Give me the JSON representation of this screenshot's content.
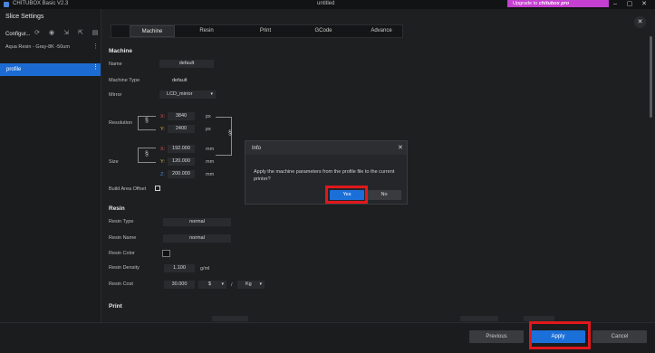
{
  "app": {
    "title": "CHITUBOX Basic V2.3",
    "document": "untitled",
    "upgrade_prefix": "Upgrade to",
    "upgrade_brand": "chitubox pro"
  },
  "window": {
    "minimize": "–",
    "maximize": "▢",
    "close": "✕"
  },
  "sidebar": {
    "title": "Slice Settings",
    "config_label": "Configur...",
    "resin_profile": "Aqua Resin - Gray-8K -50um",
    "selected_profile": "profile",
    "more": "⋮",
    "icons": [
      "refresh-icon",
      "view-icon",
      "import-icon",
      "export-icon",
      "document-icon"
    ]
  },
  "tabs": [
    {
      "label": "Machine",
      "active": true
    },
    {
      "label": "Resin",
      "active": false
    },
    {
      "label": "Print",
      "active": false
    },
    {
      "label": "GCode",
      "active": false
    },
    {
      "label": "Advance",
      "active": false
    }
  ],
  "machine": {
    "section": "Machine",
    "name_label": "Name",
    "name_value": "default",
    "type_label": "Machine Type",
    "type_value": "default",
    "mirror_label": "Mirror",
    "mirror_value": "LCD_mirror",
    "resolution_label": "Resolution",
    "res_x": "3840",
    "res_y": "2400",
    "res_unit": "px",
    "size_label": "Size",
    "size_x": "192.000",
    "size_y": "120.000",
    "size_z": "200.000",
    "size_unit": "mm",
    "build_offset_label": "Build Area Offset",
    "axis_x": "X:",
    "axis_y": "Y:",
    "axis_z": "Z:"
  },
  "resin": {
    "section": "Resin",
    "type_label": "Resin Type",
    "type_value": "normal",
    "name_label": "Resin Name",
    "name_value": "normal",
    "color_label": "Resin Color",
    "density_label": "Resin Density",
    "density_value": "1.100",
    "density_unit": "g/ml",
    "cost_label": "Resin Cost",
    "cost_value": "30.000",
    "currency": "$",
    "per": "/",
    "cost_unit": "Kg"
  },
  "print": {
    "section": "Print"
  },
  "dialog": {
    "title": "Info",
    "message": "Apply the machine parameters from the profile file to the current printer?",
    "yes": "Yes",
    "no": "No",
    "close": "✕"
  },
  "footer": {
    "previous": "Previous",
    "apply": "Apply",
    "cancel": "Cancel"
  },
  "colors": {
    "accent": "#1b6fd8",
    "highlight": "#e0181b",
    "upgrade": "#c53fd0",
    "axis_x": "#e05252",
    "axis_y": "#d8b84a",
    "axis_z": "#4a90d8"
  }
}
